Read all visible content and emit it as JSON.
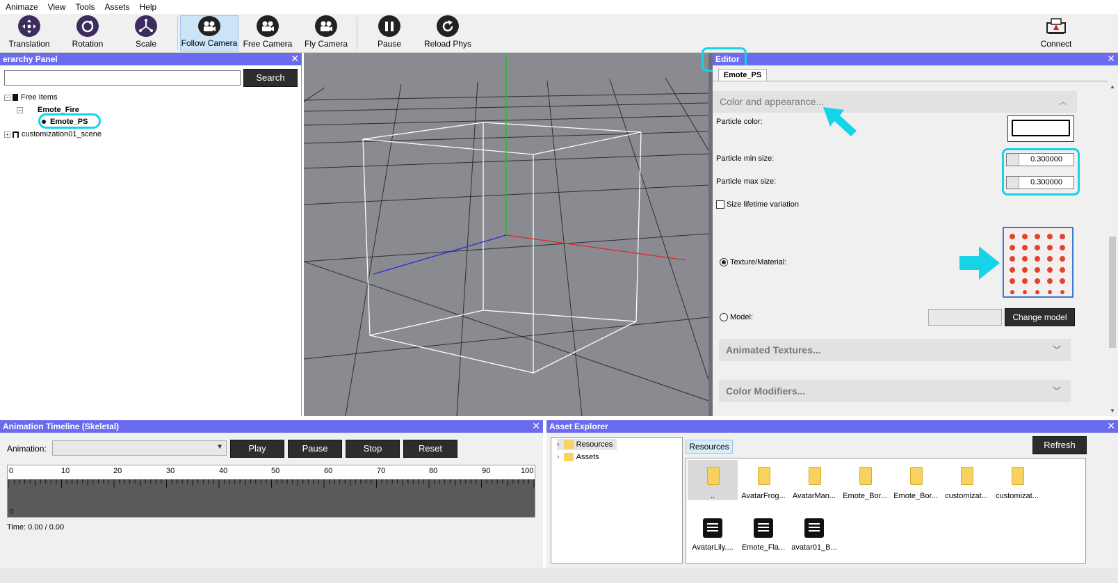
{
  "menu": [
    "Animaze",
    "View",
    "Tools",
    "Assets",
    "Help"
  ],
  "toolbar": {
    "translation": "Translation",
    "rotation": "Rotation",
    "scale": "Scale",
    "follow_camera": "Follow Camera",
    "free_camera": "Free Camera",
    "fly_camera": "Fly Camera",
    "pause": "Pause",
    "reload_phys": "Reload Phys",
    "connect": "Connect"
  },
  "hierarchy": {
    "title": "erarchy Panel",
    "search_value": "",
    "search_button": "Search",
    "tree": [
      "Free Items",
      "Emote_Fire",
      "Emote_PS",
      "customization01_scene"
    ]
  },
  "editor": {
    "title": "Editor",
    "tab": "Emote_PS",
    "sections": {
      "color_appearance": "Color and appearance...",
      "animated_textures": "Animated Textures...",
      "color_modifiers": "Color Modifiers..."
    },
    "labels": {
      "particle_color": "Particle color:",
      "min_size": "Particle min size:",
      "max_size": "Particle max size:",
      "size_lifetime": "Size lifetime variation",
      "texture_material": "Texture/Material:",
      "model": "Model:"
    },
    "values": {
      "min_size": "0.300000",
      "max_size": "0.300000",
      "size_lifetime_checked": false,
      "texture_selected": true,
      "model_value": ""
    },
    "change_model": "Change model"
  },
  "timeline": {
    "title": "Animation Timeline (Skeletal)",
    "animation_label": "Animation:",
    "animation_value": "",
    "buttons": {
      "play": "Play",
      "pause": "Pause",
      "stop": "Stop",
      "reset": "Reset"
    },
    "ticks": [
      "0",
      "10",
      "20",
      "30",
      "40",
      "50",
      "60",
      "70",
      "80",
      "90",
      "100"
    ],
    "start_marker": "0",
    "time": "Time: 0.00 / 0.00"
  },
  "assets": {
    "title": "Asset Explorer",
    "tree": [
      "Resources",
      "Assets"
    ],
    "path_tab": "Resources",
    "refresh": "Refresh",
    "folders": [
      "..",
      "AvatarFrog...",
      "AvatarMan...",
      "Emote_Bor...",
      "Emote_Bor...",
      "customizat...",
      "customizat..."
    ],
    "files": [
      "AvatarLily....",
      "Emote_Fla...",
      "avatar01_B..."
    ]
  },
  "colors": {
    "panel_header": "#6b6bef",
    "highlight": "#16d3e8",
    "viewport_bg": "#8a8a91"
  }
}
